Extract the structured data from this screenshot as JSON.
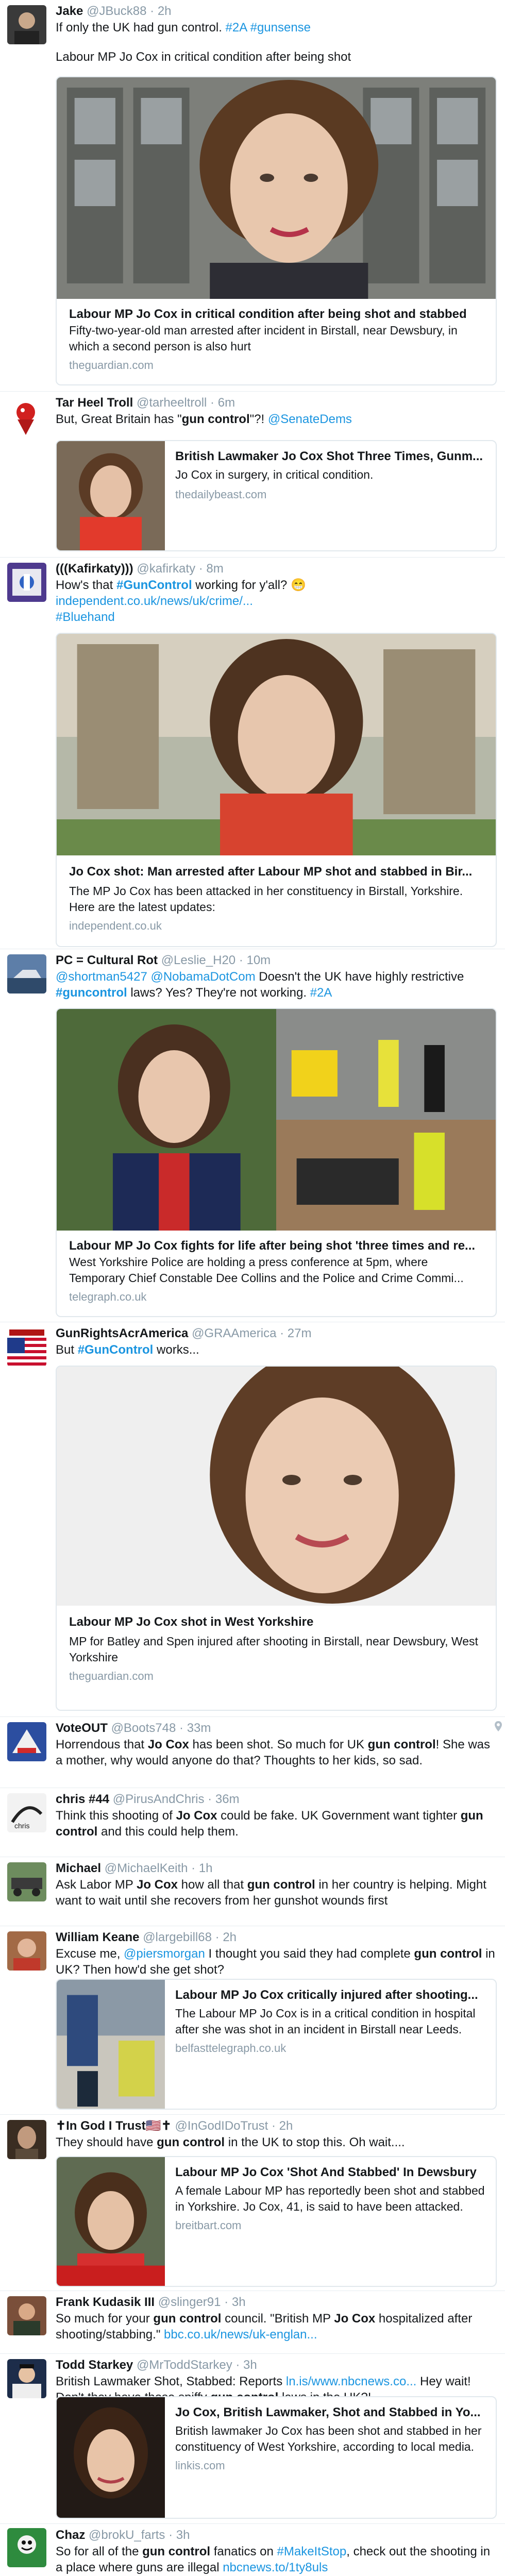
{
  "tweets": [
    {
      "name": "Jake",
      "handle": "@JBuck88",
      "time": "2h",
      "text1": "If only the UK had gun control. ",
      "tag1": "#2A",
      "tag2": "#gunsense",
      "text2": "Labour MP Jo Cox in critical condition after being shot",
      "card": {
        "title": "Labour MP Jo Cox in critical condition after being shot and stabbed",
        "desc": "Fifty-two-year-old man arrested after incident in Birstall, near Dewsbury, in which a second person is also hurt",
        "domain": "theguardian.com"
      }
    },
    {
      "name": "Tar Heel Troll",
      "handle": "@tarheeltroll",
      "time": "6m",
      "text1": "But, Great Britain has \"",
      "bold1": "gun control",
      "text2": "\"?! ",
      "mention": "@SenateDems",
      "card": {
        "title": "British Lawmaker Jo Cox Shot Three Times, Gunm...",
        "desc": "Jo Cox in surgery, in critical condition.",
        "domain": "thedailybeast.com"
      }
    },
    {
      "name": "(((Kafirkaty)))",
      "handle": "@kafirkaty",
      "time": "8m",
      "text1": "How's that ",
      "tag1": "#GunControl",
      "text2": " working for y'all? 😁",
      "link": "independent.co.uk/news/uk/crime/...",
      "tag2": "#Bluehand",
      "card": {
        "title": "Jo Cox shot: Man arrested after Labour MP shot and stabbed in Bir...",
        "desc": "The MP Jo Cox has been attacked in her constituency in Birstall, Yorkshire. Here are the latest updates:",
        "domain": "independent.co.uk"
      }
    },
    {
      "name": "PC = Cultural Rot",
      "handle": "@Leslie_H20",
      "time": "10m",
      "mention1": "@shortman5427",
      "mention2": "@NobamaDotCom",
      "text1": " Doesn't the UK have highly restrictive ",
      "bold1": "#guncontrol",
      "text2": " laws? Yes? They're not working. ",
      "tag1": "#2A",
      "card": {
        "title": "Labour MP Jo Cox fights for life after being shot 'three times and re...",
        "desc": "West Yorkshire Police are holding a press conference at 5pm, where Temporary Chief Constable Dee Collins and the Police and Crime Commi...",
        "domain": "telegraph.co.uk"
      }
    },
    {
      "name": "GunRightsAcrAmerica",
      "handle": "@GRAAmerica",
      "time": "27m",
      "text1": "But ",
      "tag1": "#GunControl",
      "text2": " works...",
      "card": {
        "title": "Labour MP Jo Cox shot in West Yorkshire",
        "desc": "MP for Batley and Spen injured after shooting in Birstall, near Dewsbury, West Yorkshire",
        "domain": "theguardian.com"
      }
    },
    {
      "name": "VoteOUT",
      "handle": "@Boots748",
      "time": "33m",
      "text1": "Horrendous that ",
      "bold1": "Jo Cox",
      "text2": " has been shot. So much for UK ",
      "bold2": "gun control",
      "text3": "! She was a mother, why would anyone do that? Thoughts to her kids, so sad."
    },
    {
      "name": "chris #44",
      "handle": "@PirusAndChris",
      "time": "36m",
      "text1": "Think this shooting of ",
      "bold1": "Jo Cox",
      "text2": " could be fake. UK Government want tighter ",
      "bold2": "gun control",
      "text3": " and this could help them."
    },
    {
      "name": "Michael",
      "handle": "@MichaelKeith",
      "time": "1h",
      "text1": "Ask Labor MP ",
      "bold1": "Jo Cox",
      "text2": " how all that ",
      "bold2": "gun control",
      "text3": " in her country is helping. Might want to wait until she recovers from her gunshot wounds first"
    },
    {
      "name": "William Keane",
      "handle": "@largebill68",
      "time": "2h",
      "text1": "Excuse me, ",
      "mention": "@piersmorgan",
      "text2": " I thought you said they had complete ",
      "bold1": "gun control",
      "text3": " in UK? Then how'd she get shot?",
      "card": {
        "title": "Labour MP Jo Cox critically injured after shooting...",
        "desc": "The Labour MP Jo Cox is in a critical condition in hospital after she was shot in an incident in Birstall near Leeds.",
        "domain": "belfasttelegraph.co.uk"
      }
    },
    {
      "name": "✝In God I Trust🇺🇸✝",
      "handle": "@InGodIDoTrust",
      "time": "2h",
      "text1": "They should have ",
      "bold1": "gun control",
      "text2": " in the UK to stop this. Oh wait....",
      "card": {
        "title": "Labour MP Jo Cox 'Shot And Stabbed' In Dewsbury",
        "desc": "A female Labour MP has reportedly been shot and stabbed in Yorkshire. Jo Cox, 41, is said to have been attacked.",
        "domain": "breitbart.com"
      }
    },
    {
      "name": "Frank Kudasik III",
      "handle": "@slinger91",
      "time": "3h",
      "text1": "So much for your ",
      "bold1": "gun control",
      "text2": " council. \"British MP ",
      "bold2": "Jo Cox",
      "text3": " hospitalized after shooting/stabbing.\" ",
      "link": "bbc.co.uk/news/uk-englan..."
    },
    {
      "name": "Todd Starkey",
      "handle": "@MrToddStarkey",
      "time": "3h",
      "text1": "British Lawmaker Shot, Stabbed: Reports ",
      "link": "ln.is/www.nbcnews.co...",
      "text2": " Hey wait! Don't they have those spiffy ",
      "bold1": "gun control",
      "text3": " laws in the UK?!",
      "card": {
        "title": "Jo Cox, British Lawmaker, Shot and Stabbed in Yo...",
        "desc": "British lawmaker Jo Cox has been shot and stabbed in her constituency of West Yorkshire, according to local media.",
        "domain": "linkis.com"
      }
    },
    {
      "name": "Chaz",
      "handle": "@brokU_farts",
      "time": "3h",
      "text1": "So for all of the ",
      "bold1": "gun control",
      "text2": " fanatics on ",
      "tag1": "#MakeItStop",
      "text3": ", check out the shooting in a place where guns are illegal ",
      "link": "nbcnews.to/1ty8uls"
    }
  ],
  "sep": "·",
  "colors": {
    "link": "#1b95e0",
    "muted": "#8899a6",
    "border": "#e1e8ed"
  }
}
